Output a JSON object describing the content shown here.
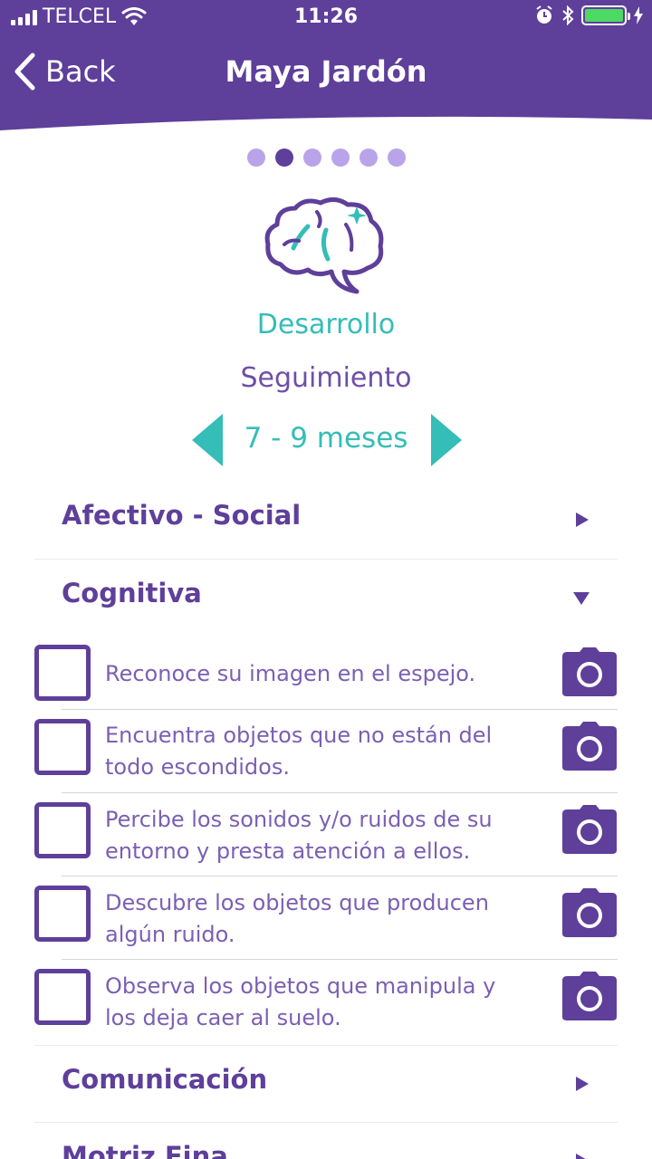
{
  "status_bar": {
    "carrier": "TELCEL",
    "time": "11:26"
  },
  "nav": {
    "back_label": "Back",
    "title": "Maya Jardón"
  },
  "pager": {
    "count": 6,
    "active_index": 1
  },
  "hero": {
    "icon": "brain-icon",
    "category": "Desarrollo",
    "subtitle": "Seguimiento",
    "age_range": "7 - 9 meses"
  },
  "sections": [
    {
      "title": "Afectivo - Social",
      "expanded": false
    },
    {
      "title": "Cognitiva",
      "expanded": true,
      "items": [
        {
          "line1": "Reconoce su imagen en el espejo.",
          "line2": ""
        },
        {
          "line1": "Encuentra objetos que no están del",
          "line2": "todo escondidos."
        },
        {
          "line1": "Percibe los sonidos y/o ruidos de su",
          "line2": "entorno y presta atención a ellos."
        },
        {
          "line1": "Descubre los objetos que producen",
          "line2": "algún ruido."
        },
        {
          "line1": "Observa los objetos que manipula y",
          "line2": "los deja caer al suelo."
        }
      ]
    },
    {
      "title": "Comunicación",
      "expanded": false
    },
    {
      "title": "Motriz Fina",
      "expanded": false
    }
  ],
  "colors": {
    "primary": "#5e3f9a",
    "accent": "#35bdb7",
    "dot_inactive": "#b9a4ea"
  }
}
